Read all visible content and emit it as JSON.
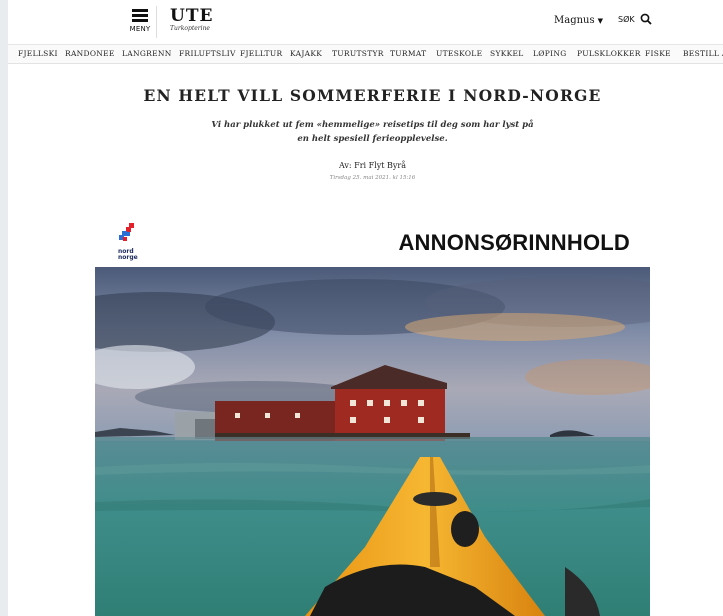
{
  "header": {
    "menu_label": "MENY",
    "logo_title": "UTE",
    "logo_subtitle": "Turkopterine",
    "user_name": "Magnus",
    "search_label": "SØK"
  },
  "nav": {
    "items": [
      "FJELLSKI",
      "RANDONEE",
      "LANGRENN",
      "FRILUFTSLIV",
      "FJELLTUR",
      "KAJAKK",
      "TURUTSTYR",
      "TURMAT",
      "UTESKOLE",
      "SYKKEL",
      "LØPING",
      "PULSKLOKKER",
      "FISKE",
      "BESTILL ABO"
    ]
  },
  "article": {
    "headline": "EN HELT VILL SOMMERFERIE I NORD-NORGE",
    "lead": "Vi har plukket ut fem «hemmelige» reisetips til deg som har lyst på en helt spesiell ferieopplevelse.",
    "byline": "Av: Fri Flyt Byrå",
    "date": "Tirsdag 25. mai 2021. kl 15:16"
  },
  "ad": {
    "logo_text_line1": "nord",
    "logo_text_line2": "norge",
    "label": "ANNONSØRINNHOLD"
  },
  "colors": {
    "logo_red": "#e3202a",
    "logo_blue": "#2a6fd6",
    "kayak_yellow": "#f0a91e",
    "water": "#3e8e8a",
    "building_red": "#9e2a22"
  }
}
